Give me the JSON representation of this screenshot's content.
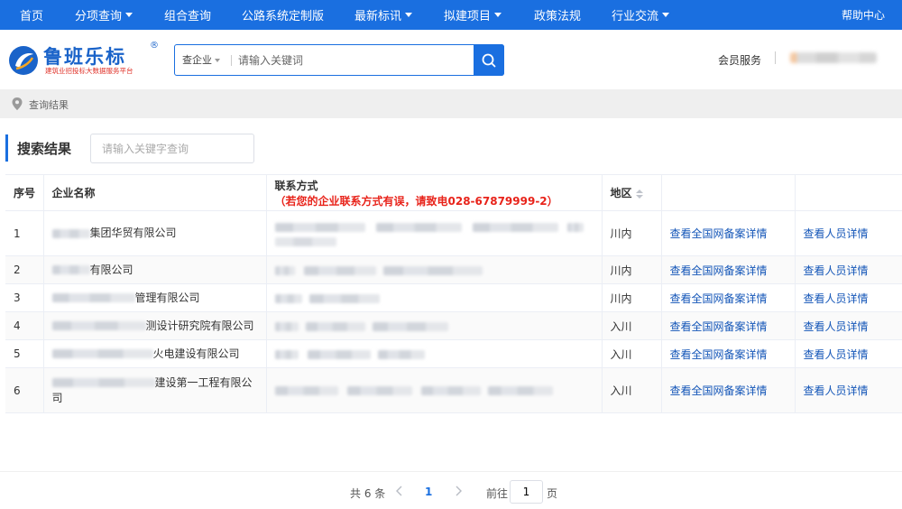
{
  "topnav": {
    "items": [
      {
        "label": "首页",
        "has_caret": false
      },
      {
        "label": "分项查询",
        "has_caret": true
      },
      {
        "label": "组合查询",
        "has_caret": false
      },
      {
        "label": "公路系统定制版",
        "has_caret": false
      },
      {
        "label": "最新标讯",
        "has_caret": true
      },
      {
        "label": "拟建项目",
        "has_caret": true
      },
      {
        "label": "政策法规",
        "has_caret": false
      },
      {
        "label": "行业交流",
        "has_caret": true
      }
    ],
    "help": "帮助中心"
  },
  "header": {
    "logo_name": "鲁班乐标",
    "logo_reg": "®",
    "logo_slogan": "建筑业招投标大数据服务平台",
    "search_scope": "查企业",
    "search_placeholder": "请输入关键词",
    "member_service": "会员服务"
  },
  "breadcrumb": {
    "text": "查询结果"
  },
  "panel": {
    "title": "搜索结果",
    "filter_placeholder": "请输入关键字查询"
  },
  "table": {
    "headers": {
      "index": "序号",
      "company": "企业名称",
      "contact": "联系方式",
      "contact_note": "（若您的企业联系方式有误，请致电028-67879999-2）",
      "region": "地区",
      "col5": "",
      "col6": ""
    },
    "rows": [
      {
        "index": "1",
        "company_suffix": "集团华贸有限公司",
        "region": "川内",
        "link1": "查看全国网备案详情",
        "link2": "查看人员详情"
      },
      {
        "index": "2",
        "company_suffix": "有限公司",
        "region": "川内",
        "link1": "查看全国网备案详情",
        "link2": "查看人员详情"
      },
      {
        "index": "3",
        "company_suffix": "管理有限公司",
        "region": "川内",
        "link1": "查看全国网备案详情",
        "link2": "查看人员详情"
      },
      {
        "index": "4",
        "company_suffix": "测设计研究院有限公司",
        "region": "入川",
        "link1": "查看全国网备案详情",
        "link2": "查看人员详情"
      },
      {
        "index": "5",
        "company_suffix": "火电建设有限公司",
        "region": "入川",
        "link1": "查看全国网备案详情",
        "link2": "查看人员详情"
      },
      {
        "index": "6",
        "company_suffix": "建设第一工程有限公",
        "company_suffix2": "司",
        "region": "入川",
        "link1": "查看全国网备案详情",
        "link2": "查看人员详情"
      }
    ]
  },
  "pager": {
    "total": "共 6 条",
    "current_page": "1",
    "goto_label": "前往",
    "goto_value": "1",
    "unit": "页"
  },
  "colors": {
    "primary": "#1a6fe0",
    "link": "#1456b8",
    "highlight": "#e8231a"
  }
}
